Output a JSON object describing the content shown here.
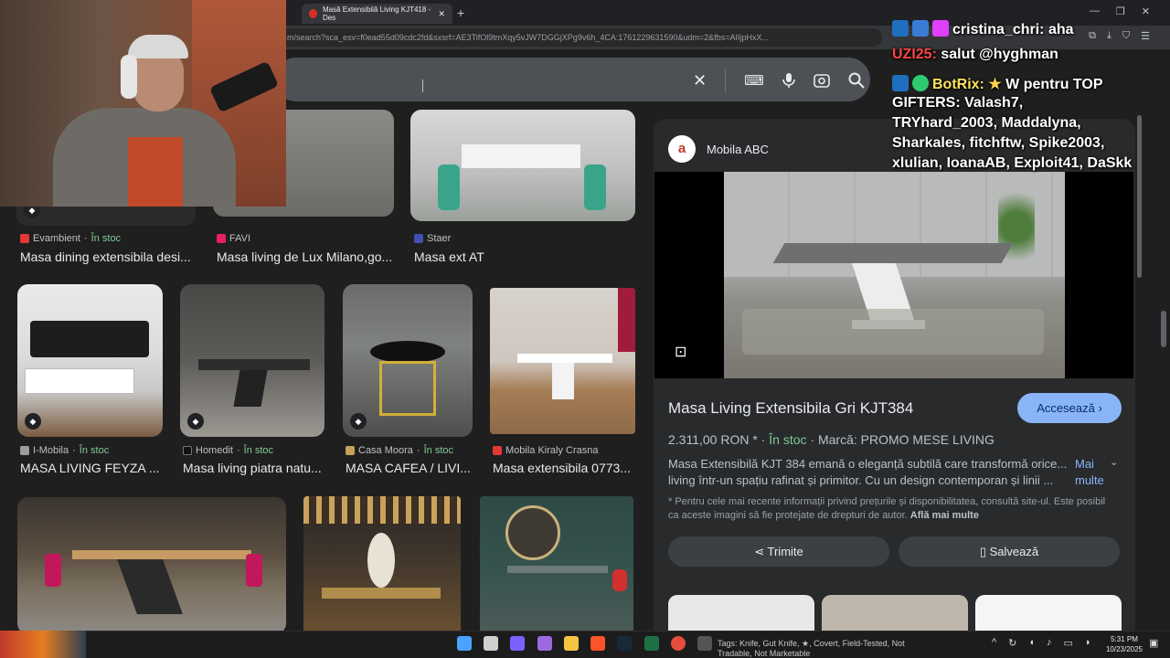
{
  "browser": {
    "tab_title": "Masă Extensibilă Living KJT418 - Des",
    "url": "m/search?sca_esv=f0ead55d09cdc2fd&sxsrf=AE3TifOl9tmXqy5vJW7DGGjXPg9v6h_4CA:1761229631590&udm=2&fbs=AIIjpHxX..."
  },
  "results": [
    {
      "source": "Evambient",
      "stock": "În stoc",
      "title": "Masa dining extensibila desi..."
    },
    {
      "source": "FAVI",
      "stock": "",
      "title": "Masa living de Lux Milano,go..."
    },
    {
      "source": "Staer",
      "stock": "",
      "title": "Masa ext AT"
    },
    {
      "source": "I-Mobila",
      "stock": "În stoc",
      "title": "MASA LIVING FEYZA ..."
    },
    {
      "source": "Homedit",
      "stock": "În stoc",
      "title": "Masa living piatra natu..."
    },
    {
      "source": "Casa Moora",
      "stock": "În stoc",
      "title": "MASA CAFEA / LIVI..."
    },
    {
      "source": "Mobila Kiraly Crasna",
      "stock": "",
      "title": "Masa extensibila 0773..."
    }
  ],
  "panel": {
    "store": "Mobila ABC",
    "title": "Masa Living Extensibila Gri KJT384",
    "visit": "Accesează",
    "price": "2.311,00 RON *",
    "stock": "În stoc",
    "brand": "Marcă: PROMO MESE LIVING",
    "desc_line1": "Masa Extensibilă KJT 384 emană o eleganță subtilă care transformă orice...",
    "desc_line2": "living într-un spațiu rafinat și primitor. Cu un design contemporan și linii ...",
    "more": "Mai multe",
    "note": "* Pentru cele mai recente informații privind prețurile și disponibilitatea, consultă site-ul. Este posibil ca aceste imagini să fie protejate de drepturi de autor.",
    "note_link": "Află mai multe",
    "share": "Trimite",
    "save": "Salvează"
  },
  "chat": {
    "l1_user": "cristina_chri:",
    "l1_msg": "aha",
    "l2_user": "UZI25:",
    "l2_msg": "salut @hyghman",
    "l3_user": "BotRix:",
    "l3_msg": "W pentru TOP",
    "l4": "GIFTERS: Valash7,",
    "l5": "TRYhard_2003, Maddalyna,",
    "l6": "Sharkales, fitchftw, Spike2003,",
    "l7": "xlulian, IoanaAB, Exploit41, DaSkk"
  },
  "taskbar": {
    "tags": "Tags: Knife, Gut Knife, ★, Covert, Field-Tested, Not Tradable, Not Marketable",
    "time": "5:31 PM",
    "date": "10/23/2025"
  },
  "colors": {
    "accent": "#8ab4f8",
    "in_stock": "#81c995",
    "background": "#1f1f1f"
  }
}
